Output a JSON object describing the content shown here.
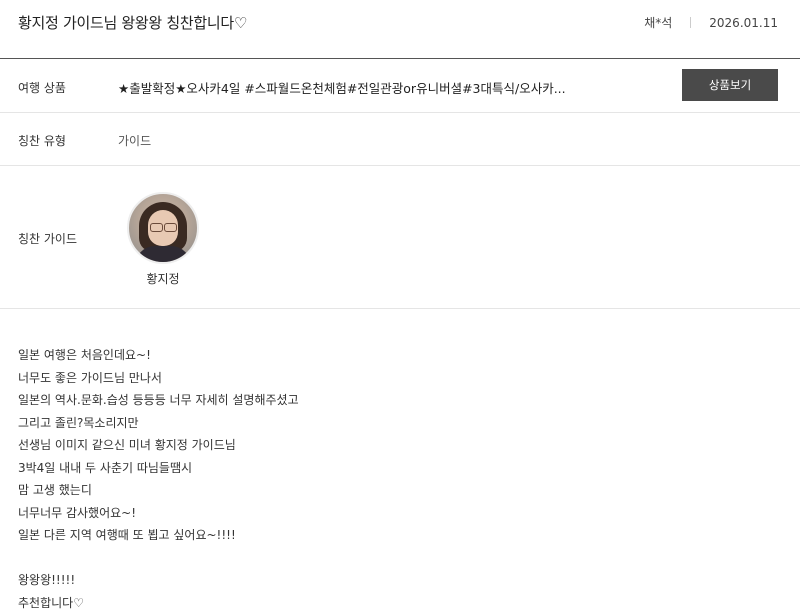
{
  "header": {
    "title": "황지정 가이드님 왕왕왕 칭찬합니다♡",
    "author": "채*석",
    "date": "2026.01.11"
  },
  "product": {
    "label": "여행 상품",
    "value": "★출발확정★오사카4일 #스파월드온천체험#전일관광or유니버셜#3대특식/오사카...",
    "button_label": "상품보기"
  },
  "praise_type": {
    "label": "칭찬 유형",
    "value": "가이드"
  },
  "praise_guide": {
    "label": "칭찬 가이드",
    "name": "황지정"
  },
  "content": {
    "lines": [
      "일본 여행은 처음인데요~!",
      "너무도 좋은 가이드님 만나서",
      "일본의 역사.문화.습성 등등등 너무 자세히 설명해주셨고",
      "그리고 졸린?목소리지만",
      "선생님 이미지 같으신 미녀 황지정 가이드님",
      "3박4일 내내 두 사춘기 따님들땜시",
      "맘 고생 했는디",
      "너무너무 감사했어요~!",
      "일본 다른 지역 여행때 또 뵙고 싶어요~!!!!",
      "",
      "왕왕왕!!!!!",
      "추천합니다♡"
    ]
  }
}
